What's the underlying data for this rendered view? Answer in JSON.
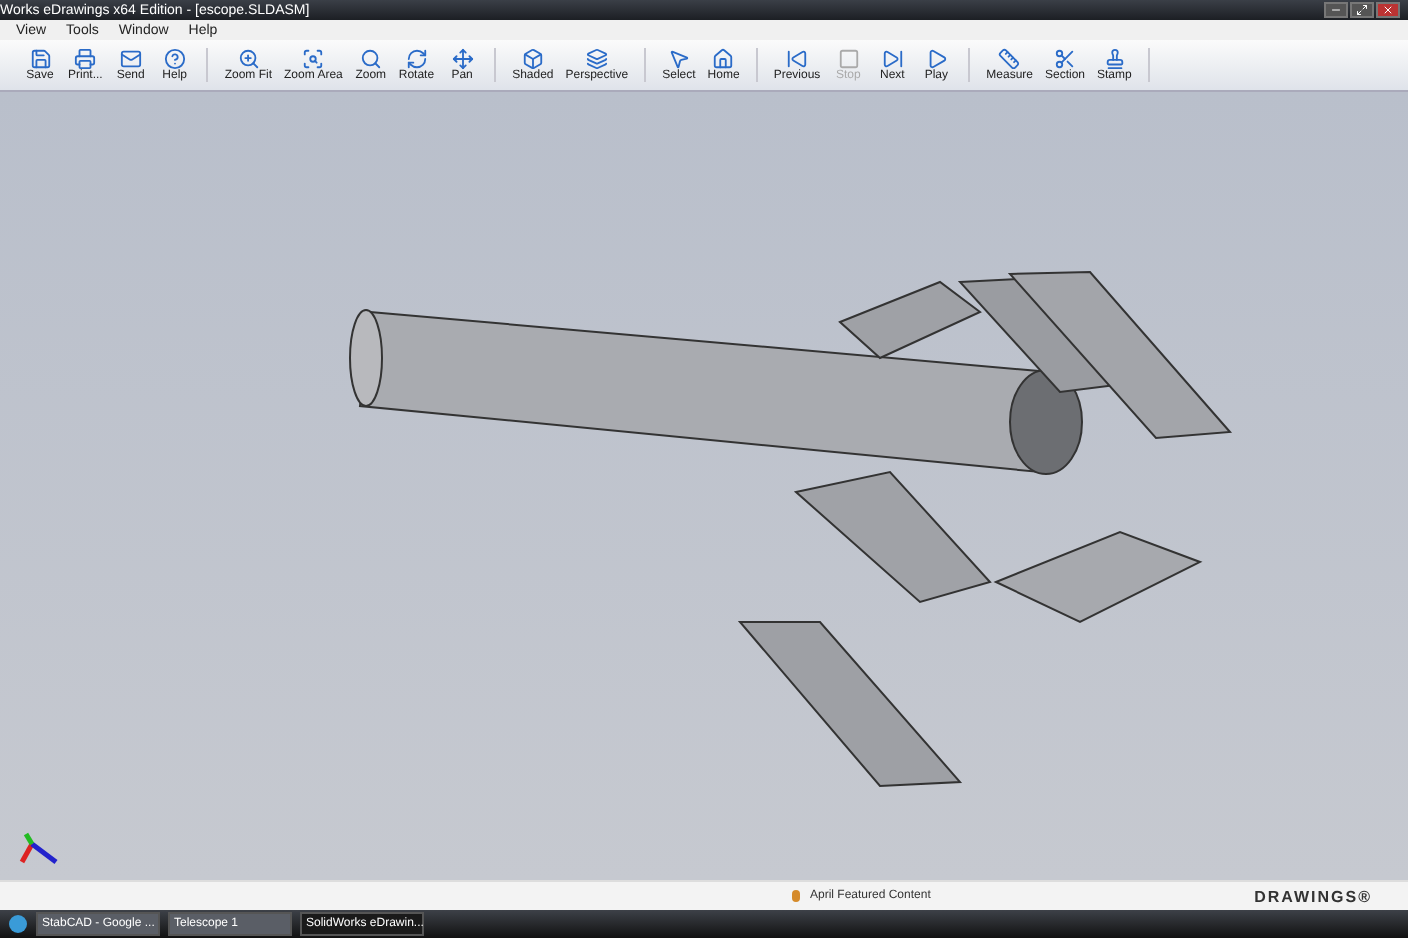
{
  "window": {
    "title": "Works eDrawings x64 Edition - [escope.SLDASM]"
  },
  "menu": [
    "View",
    "Tools",
    "Window",
    "Help"
  ],
  "toolbar": [
    [
      {
        "label": "Save",
        "disabled": false
      },
      {
        "label": "Print...",
        "disabled": false
      },
      {
        "label": "Send",
        "disabled": false
      },
      {
        "label": "Help",
        "disabled": false
      }
    ],
    [
      {
        "label": "Zoom Fit",
        "disabled": false
      },
      {
        "label": "Zoom Area",
        "disabled": false
      },
      {
        "label": "Zoom",
        "disabled": false
      },
      {
        "label": "Rotate",
        "disabled": false
      },
      {
        "label": "Pan",
        "disabled": false
      }
    ],
    [
      {
        "label": "Shaded",
        "disabled": false
      },
      {
        "label": "Perspective",
        "disabled": false
      }
    ],
    [
      {
        "label": "Select",
        "disabled": false
      },
      {
        "label": "Home",
        "disabled": false
      }
    ],
    [
      {
        "label": "Previous",
        "disabled": false
      },
      {
        "label": "Stop",
        "disabled": true
      },
      {
        "label": "Next",
        "disabled": false
      },
      {
        "label": "Play",
        "disabled": false
      }
    ],
    [
      {
        "label": "Measure",
        "disabled": false
      },
      {
        "label": "Section",
        "disabled": false
      },
      {
        "label": "Stamp",
        "disabled": false
      }
    ]
  ],
  "status_bar": {
    "message": "April Featured Content",
    "brand": "DRAWINGS®"
  },
  "taskbar": {
    "tasks": [
      {
        "label": "StabCAD - Google ...",
        "selected": false
      },
      {
        "label": "Telescope 1",
        "selected": false
      },
      {
        "label": "SolidWorks eDrawin...",
        "selected": true
      }
    ]
  }
}
